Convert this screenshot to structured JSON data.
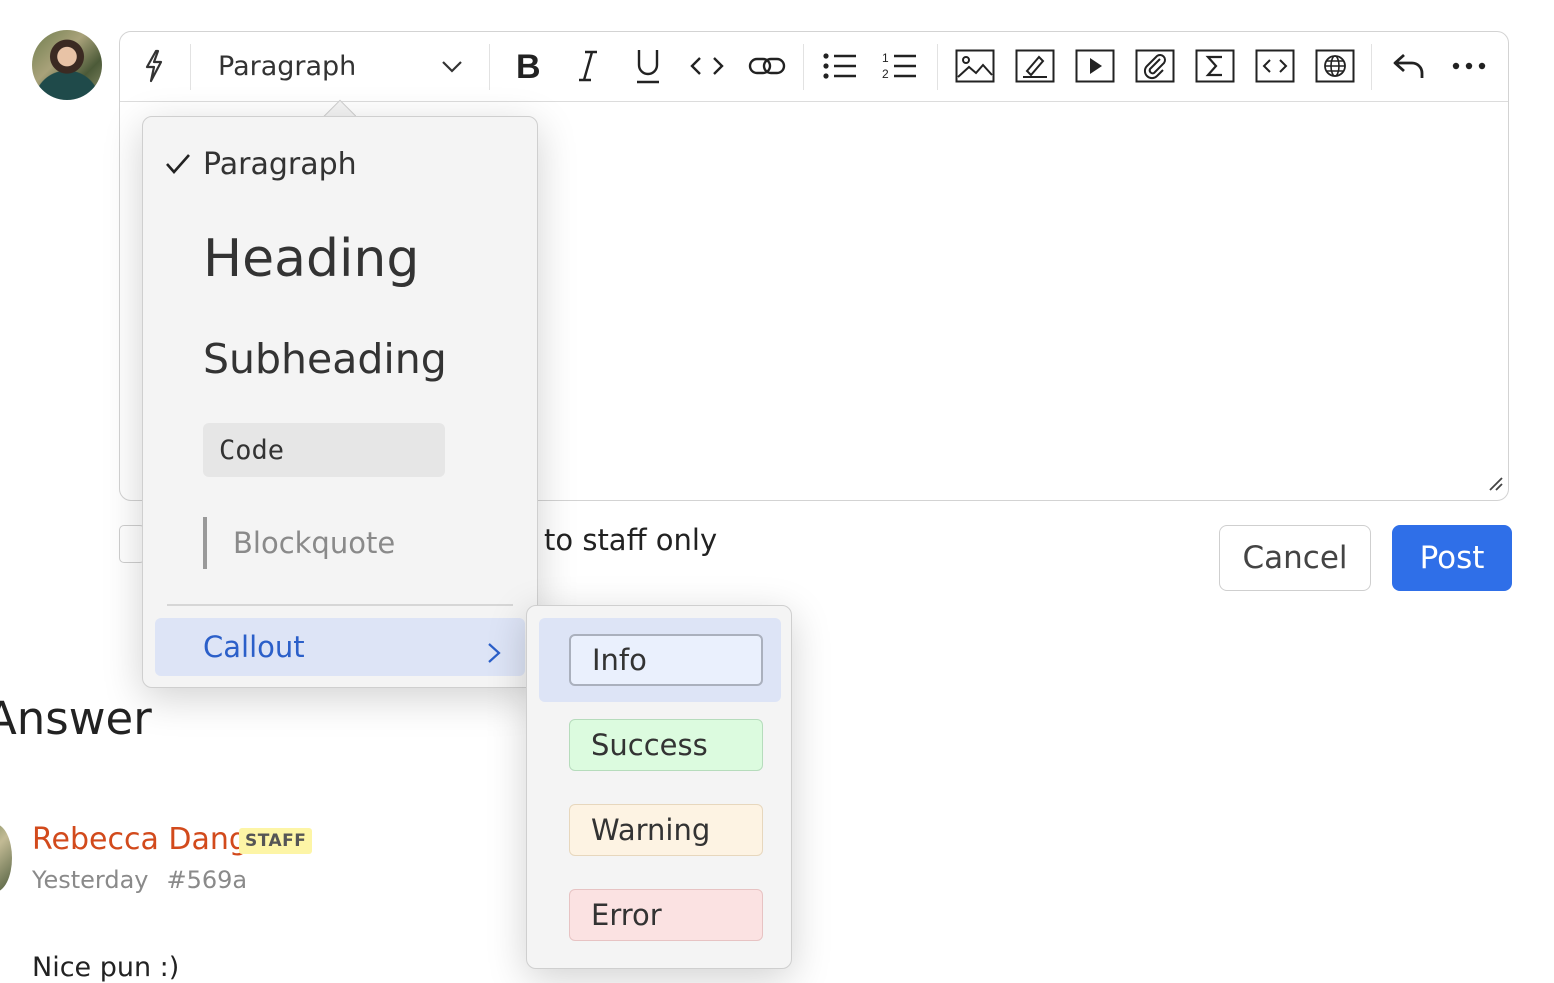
{
  "toolbar": {
    "block_type": "Paragraph",
    "icons": [
      "lightning-icon",
      "bold-icon",
      "italic-icon",
      "underline-icon",
      "code-inline-icon",
      "link-icon",
      "bullet-list-icon",
      "numbered-list-icon",
      "image-icon",
      "draw-icon",
      "video-icon",
      "attachment-icon",
      "math-icon",
      "code-block-icon",
      "web-embed-icon",
      "undo-icon",
      "more-icon"
    ]
  },
  "block_menu": {
    "paragraph": "Paragraph",
    "heading": "Heading",
    "subheading": "Subheading",
    "code": "Code",
    "blockquote": "Blockquote",
    "callout": "Callout",
    "selected": "Paragraph"
  },
  "callout_menu": {
    "info": "Info",
    "success": "Success",
    "warning": "Warning",
    "error": "Error"
  },
  "form": {
    "staff_only_label": "to staff only",
    "cancel_label": "Cancel",
    "post_label": "Post"
  },
  "answer": {
    "heading": "Answer",
    "author": "Rebecca Dang",
    "badge": "STAFF",
    "time": "Yesterday",
    "id": "#569a",
    "comment_preview": "Nice pun :)"
  },
  "colors": {
    "accent": "#2f6fe8",
    "author": "#d24a1c",
    "menu_highlight": "#dde4f6",
    "callout_text": "#2b5fc9"
  }
}
